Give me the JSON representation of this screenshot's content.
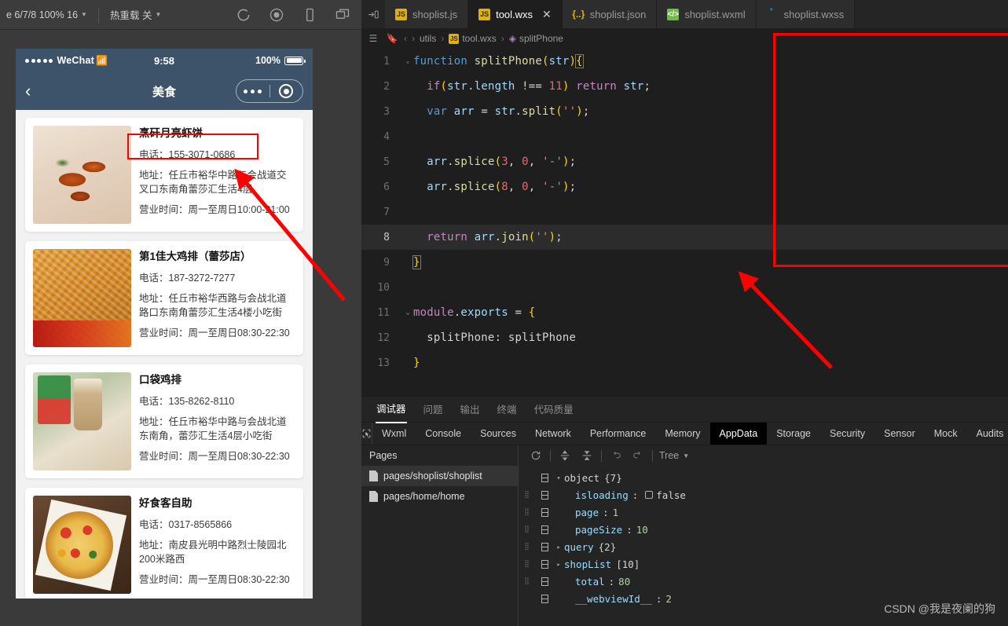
{
  "simulator": {
    "toolbar": {
      "device_label": "e 6/7/8 100% 16",
      "hotreload_label": "热重载 关",
      "icons": [
        "compile-refresh-icon",
        "record-icon",
        "phone-preview-icon",
        "split-window-icon"
      ]
    },
    "status_bar": {
      "carrier": "WeChat",
      "time": "9:58",
      "battery": "100%"
    },
    "nav_bar": {
      "title": "美食",
      "back_icon": "chevron-left-icon"
    },
    "cards": [
      {
        "title": "烹矸月亮虾饼",
        "phone": "电话：155-3071-0686",
        "address": "地址：任丘市裕华中路与会战道交叉口东南角蕾莎汇生活4层",
        "hours": "营业时间：周一至周日10:00-21:00",
        "thumb": "art-shrimp"
      },
      {
        "title": "第1佳大鸡排（蕾莎店）",
        "phone": "电话：187-3272-7277",
        "address": "地址：任丘市裕华西路与会战北道路口东南角蕾莎汇生活4楼小吃街",
        "hours": "营业时间：周一至周日08:30-22:30",
        "thumb": "art-chicken"
      },
      {
        "title": "口袋鸡排",
        "phone": "电话：135-8262-8110",
        "address": "地址：任丘市裕华中路与会战北道东南角，蕾莎汇生活4层小吃街",
        "hours": "营业时间：周一至周日08:30-22:30",
        "thumb": "art-cup"
      },
      {
        "title": "好食客自助",
        "phone": "电话：0317-8565866",
        "address": "地址：南皮县光明中路烈士陵园北200米路西",
        "hours": "营业时间：周一至周日08:30-22:30",
        "thumb": "art-pizza"
      }
    ]
  },
  "editor": {
    "tabs": [
      {
        "label": "shoplist.js",
        "icon": "js-file-icon",
        "active": false,
        "closable": false
      },
      {
        "label": "tool.wxs",
        "icon": "js-file-icon",
        "active": true,
        "closable": true
      },
      {
        "label": "shoplist.json",
        "icon": "json-file-icon",
        "active": false,
        "closable": false
      },
      {
        "label": "shoplist.wxml",
        "icon": "wxml-file-icon",
        "active": false,
        "closable": false
      },
      {
        "label": "shoplist.wxss",
        "icon": "wxss-file-icon",
        "active": false,
        "closable": false
      }
    ],
    "close_glyph": "✕",
    "breadcrumb": {
      "items": [
        "utils",
        "tool.wxs",
        "splitPhone"
      ],
      "separator": "›"
    },
    "code_lines": [
      {
        "n": "1",
        "fold": "⌄",
        "highlight": false
      },
      {
        "n": "2",
        "fold": "",
        "highlight": false
      },
      {
        "n": "3",
        "fold": "",
        "highlight": false
      },
      {
        "n": "4",
        "fold": "",
        "highlight": false
      },
      {
        "n": "5",
        "fold": "",
        "highlight": false
      },
      {
        "n": "6",
        "fold": "",
        "highlight": false
      },
      {
        "n": "7",
        "fold": "",
        "highlight": false
      },
      {
        "n": "8",
        "fold": "",
        "highlight": true
      },
      {
        "n": "9",
        "fold": "",
        "highlight": false
      },
      {
        "n": "10",
        "fold": "",
        "highlight": false
      },
      {
        "n": "11",
        "fold": "⌄",
        "highlight": false
      },
      {
        "n": "12",
        "fold": "",
        "highlight": false
      },
      {
        "n": "13",
        "fold": "",
        "highlight": false
      }
    ],
    "code_text": [
      "function splitPhone(str){",
      "  if(str.length !== 11) return str;",
      "  var arr = str.split('');",
      "",
      "  arr.splice(3, 0, '-');",
      "  arr.splice(8, 0, '-');",
      "",
      "  return arr.join('');",
      "}",
      "",
      "module.exports = {",
      "  splitPhone: splitPhone",
      "}"
    ]
  },
  "devtools": {
    "cn_tabs": [
      {
        "label": "调试器",
        "active": true
      },
      {
        "label": "问题",
        "active": false
      },
      {
        "label": "输出",
        "active": false
      },
      {
        "label": "终端",
        "active": false
      },
      {
        "label": "代码质量",
        "active": false
      }
    ],
    "en_tabs": [
      {
        "label": "Wxml",
        "active": false
      },
      {
        "label": "Console",
        "active": false
      },
      {
        "label": "Sources",
        "active": false
      },
      {
        "label": "Network",
        "active": false
      },
      {
        "label": "Performance",
        "active": false
      },
      {
        "label": "Memory",
        "active": false
      },
      {
        "label": "AppData",
        "active": true
      },
      {
        "label": "Storage",
        "active": false
      },
      {
        "label": "Security",
        "active": false
      },
      {
        "label": "Sensor",
        "active": false
      },
      {
        "label": "Mock",
        "active": false
      },
      {
        "label": "Audits",
        "active": false
      }
    ],
    "inspect_icon": "inspect-cursor-icon",
    "pages": {
      "header": "Pages",
      "items": [
        {
          "label": "pages/shoplist/shoplist",
          "selected": true
        },
        {
          "label": "pages/home/home",
          "selected": false
        }
      ]
    },
    "tree_toolbar": {
      "refresh_icon": "refresh-icon",
      "expand_icon": "expand-all-icon",
      "collapse_icon": "collapse-all-icon",
      "undo_icon": "undo-icon",
      "redo_icon": "redo-icon",
      "view_mode": "Tree"
    },
    "appdata": {
      "root": {
        "key": "object",
        "count": "{7}",
        "arrow": "▾"
      },
      "rows": [
        {
          "key": "isloading",
          "sep": ":",
          "value": "false",
          "kind": "bool",
          "arrow": ""
        },
        {
          "key": "page",
          "sep": ":",
          "value": "1",
          "kind": "num",
          "arrow": ""
        },
        {
          "key": "pageSize",
          "sep": ":",
          "value": "10",
          "kind": "num",
          "arrow": ""
        },
        {
          "key": "query",
          "sep": "",
          "value": "{2}",
          "kind": "count",
          "arrow": "▸"
        },
        {
          "key": "shopList",
          "sep": "",
          "value": "[10]",
          "kind": "count",
          "arrow": "▸"
        },
        {
          "key": "total",
          "sep": ":",
          "value": "80",
          "kind": "num",
          "arrow": ""
        },
        {
          "key": "__webviewId__",
          "sep": ":",
          "value": "2",
          "kind": "num",
          "arrow": ""
        }
      ]
    }
  },
  "watermark": "CSDN @我是夜阑的狗",
  "annotations": {
    "rect_code": "red-highlight-rectangle-code",
    "rect_phone": "red-highlight-rectangle-phone",
    "arrow_color": "#ff0000"
  }
}
